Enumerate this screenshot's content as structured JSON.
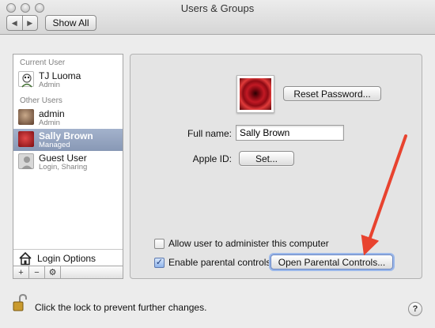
{
  "window": {
    "title": "Users & Groups"
  },
  "toolbar": {
    "back_icon": "chevron-left-icon",
    "forward_icon": "chevron-right-icon",
    "show_all_label": "Show All"
  },
  "sidebar": {
    "current_user_header": "Current User",
    "other_users_header": "Other Users",
    "current_user": {
      "name": "TJ Luoma",
      "role": "Admin"
    },
    "other_users": [
      {
        "name": "admin",
        "role": "Admin",
        "selected": false
      },
      {
        "name": "Sally Brown",
        "role": "Managed",
        "selected": true
      },
      {
        "name": "Guest User",
        "role": "Login, Sharing",
        "selected": false
      }
    ],
    "login_options_label": "Login Options",
    "login_options_icon": "house-icon",
    "buttons": {
      "add": "+",
      "remove": "−",
      "action_icon": "gear-icon"
    }
  },
  "main": {
    "reset_password_label": "Reset Password...",
    "full_name_label": "Full name:",
    "full_name_value": "Sally Brown",
    "apple_id_label": "Apple ID:",
    "set_label": "Set...",
    "allow_admin_label": "Allow user to administer this computer",
    "allow_admin_checked": false,
    "enable_parental_label": "Enable parental controls",
    "enable_parental_checked": true,
    "open_parental_label": "Open Parental Controls..."
  },
  "footer": {
    "lock_text": "Click the lock to prevent further changes.",
    "lock_icon": "lock-open-icon",
    "help_label": "?"
  },
  "colors": {
    "annotation_arrow": "#e8432f",
    "selection": "#8898b5"
  }
}
